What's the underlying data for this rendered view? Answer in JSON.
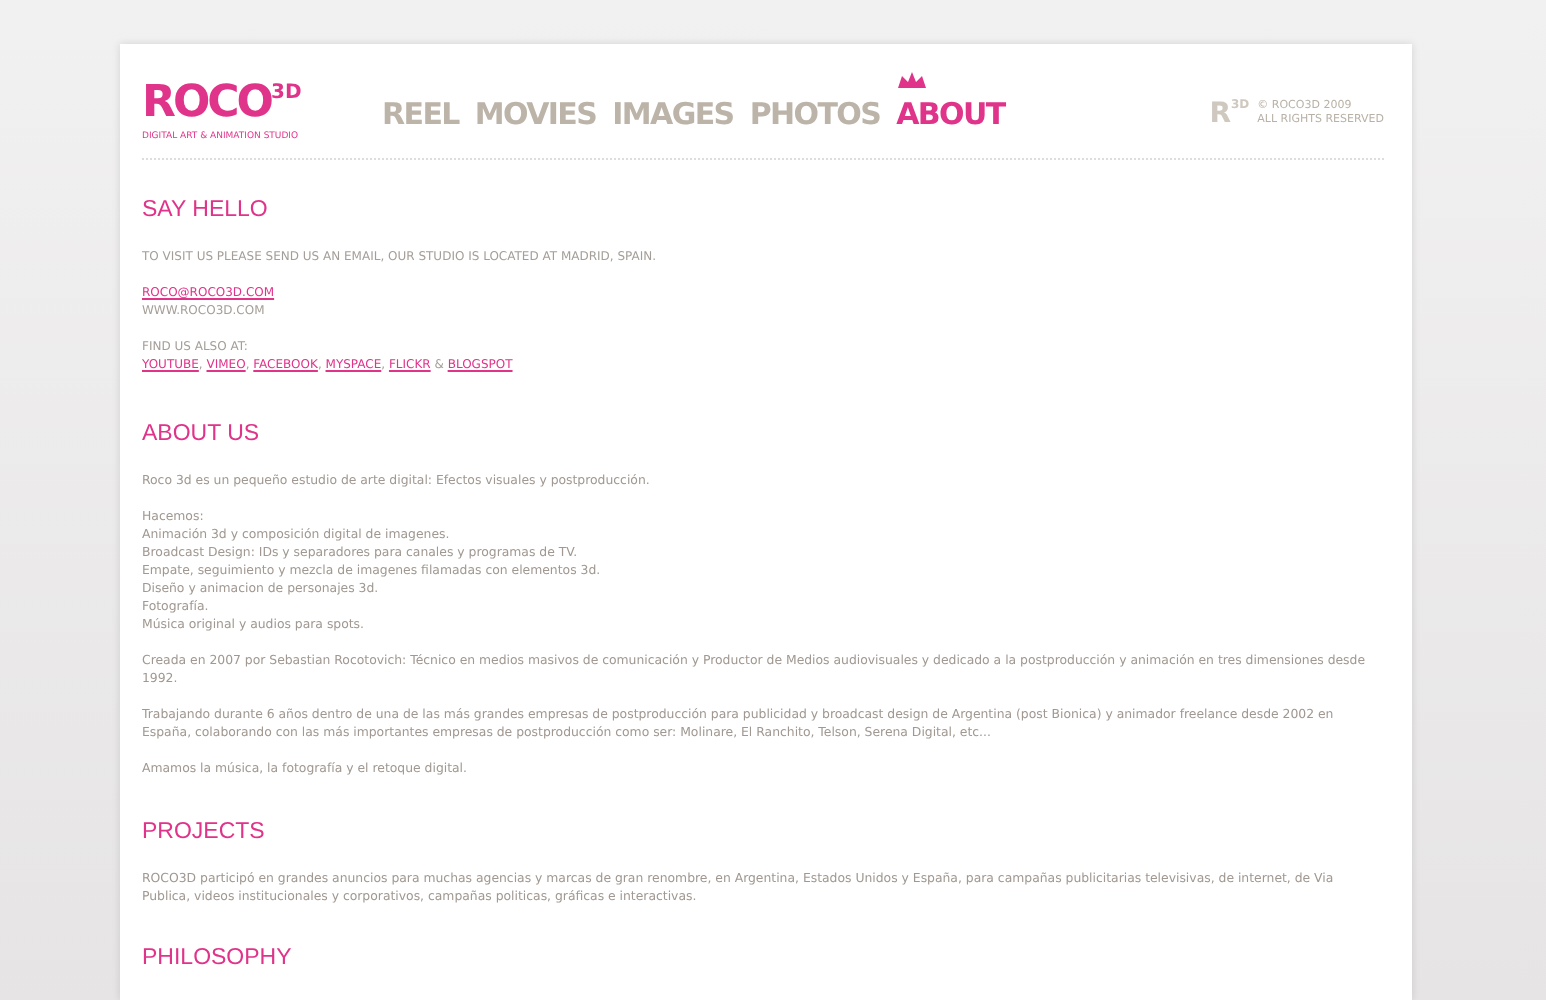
{
  "logo": {
    "name": "ROCO",
    "sup": "3D",
    "tagline": "DIGITAL ART & ANIMATION STUDIO"
  },
  "nav": [
    {
      "label": "REEL",
      "selected": false
    },
    {
      "label": "MOVIES",
      "selected": false
    },
    {
      "label": "IMAGES",
      "selected": false
    },
    {
      "label": "PHOTOS",
      "selected": false
    },
    {
      "label": "ABOUT",
      "selected": true
    }
  ],
  "copyright": {
    "mark": "R",
    "mark_sup": "3D",
    "lines": [
      "© ROCO3D 2009",
      "ALL RIGHTS RESERVED"
    ]
  },
  "say_hello": {
    "title": "SAY HELLO",
    "intro": "TO VISIT US PLEASE SEND US AN EMAIL, OUR STUDIO IS LOCATED AT MADRID, SPAIN.",
    "email": "ROCO@ROCO3D.COM",
    "web": "WWW.ROCO3D.COM",
    "find_label": "FIND US ALSO AT:",
    "links": [
      {
        "label": "YOUTUBE",
        "sep": ", "
      },
      {
        "label": "VIMEO",
        "sep": ", "
      },
      {
        "label": "FACEBOOK",
        "sep": ", "
      },
      {
        "label": "MYSPACE",
        "sep": ", "
      },
      {
        "label": "FLICKR",
        "sep": " & "
      },
      {
        "label": "BLOGSPOT"
      }
    ]
  },
  "about_us": {
    "title": "ABOUT US",
    "blocks": [
      [
        "Roco 3d es un pequeño estudio de arte digital: Efectos visuales y postproducción."
      ],
      [
        "Hacemos:",
        "Animación 3d y composición digital de imagenes.",
        "Broadcast Design: IDs y separadores para canales y programas de TV.",
        "Empate, seguimiento y mezcla de imagenes filamadas con elementos 3d.",
        "Diseño y animacion de personajes 3d.",
        "Fotografía.",
        "Música original y audios para spots."
      ],
      [
        "Creada en 2007 por Sebastian Rocotovich: Técnico en medios masivos de comunicación y Productor de Medios audiovisuales y dedicado a la postproducción y animación en tres dimensiones desde 1992."
      ],
      [
        "Trabajando durante 6 años dentro de una de las más grandes empresas de postproducción para publicidad y broadcast design de Argentina (post Bionica) y animador freelance desde 2002 en España, colaborando con las más importantes empresas de postproducción como ser: Molinare, El Ranchito, Telson, Serena Digital, etc..."
      ],
      [
        "Amamos la música, la fotografía y el retoque digital."
      ]
    ]
  },
  "projects": {
    "title": "PROJECTS",
    "text": "ROCO3D participó en grandes anuncios para muchas agencias y marcas de gran renombre, en Argentina, Estados Unidos y España, para campañas publicitarias televisivas, de internet, de Via Publica, videos institucionales y corporativos, campañas politicas, gráficas e interactivas."
  },
  "philosophy": {
    "title": "PHILOSOPHY"
  }
}
